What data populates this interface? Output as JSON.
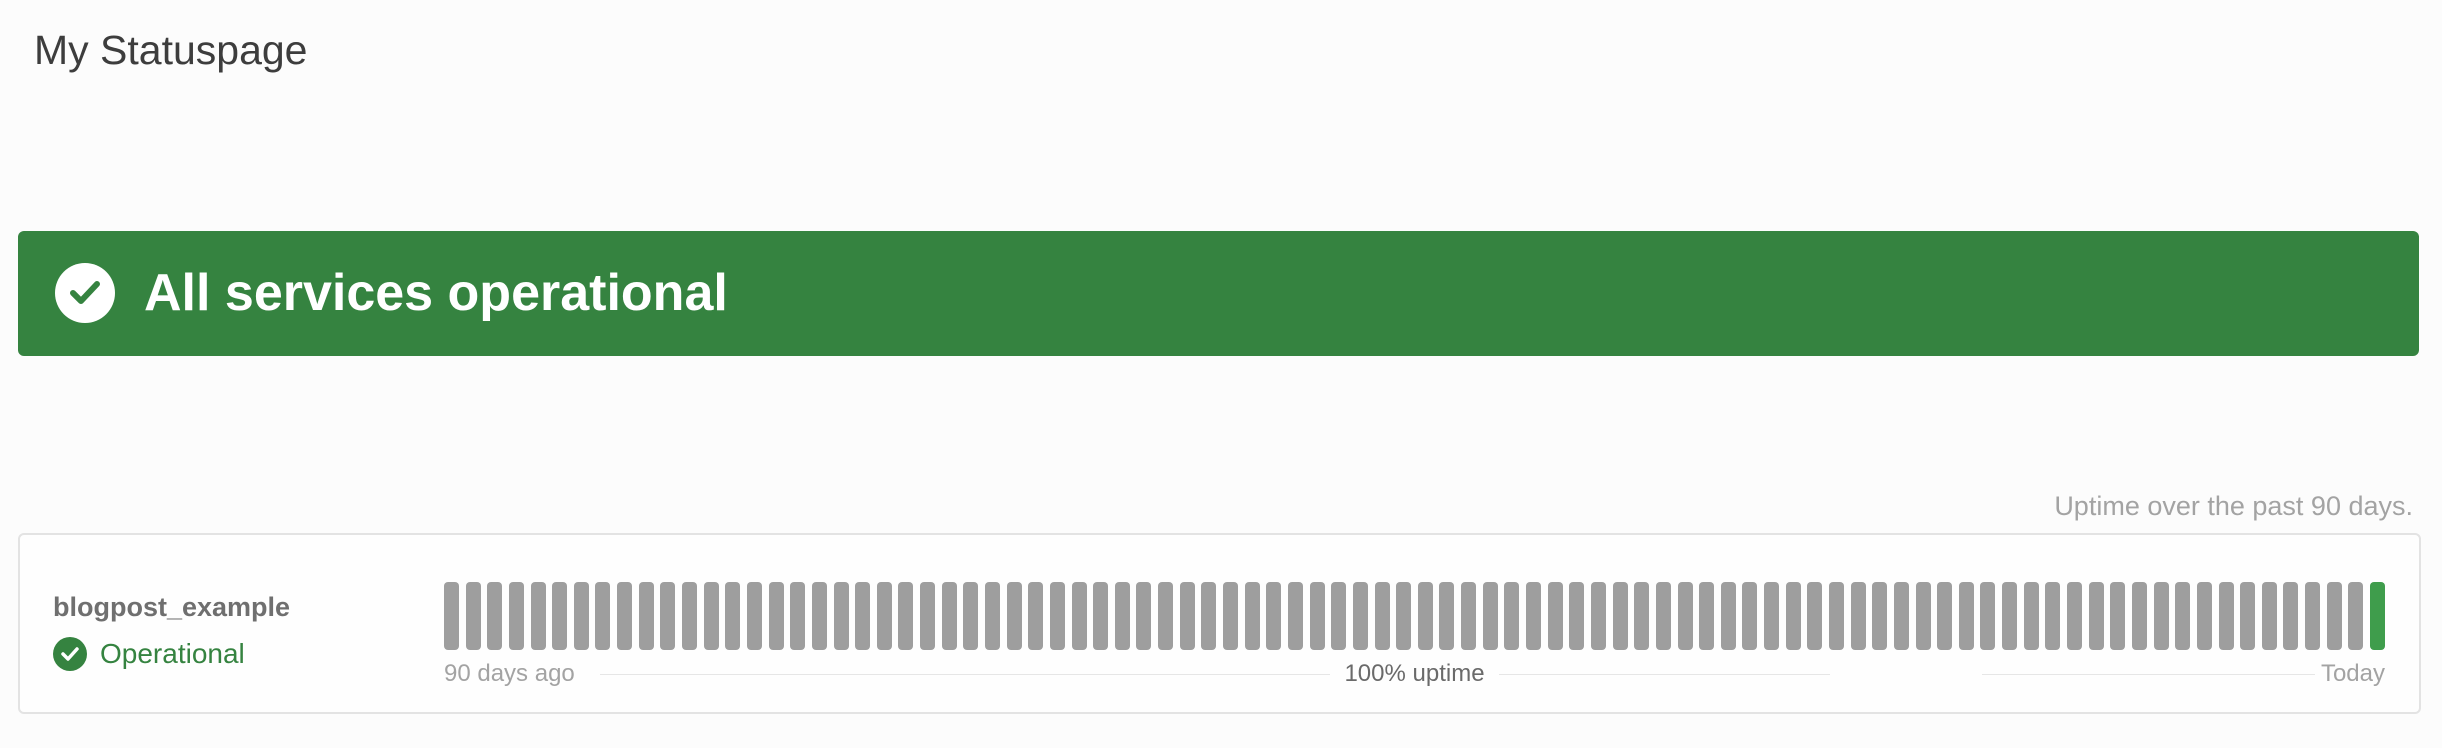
{
  "page": {
    "title": "My Statuspage"
  },
  "banner": {
    "icon": "check-circle-icon",
    "text": "All services operational",
    "color": "#358340"
  },
  "uptime_note": "Uptime over the past 90 days.",
  "components": [
    {
      "name": "blogpost_example",
      "status_icon": "check-circle-icon",
      "status": "Operational",
      "status_color": "#358340",
      "days_shown": 90,
      "days_with_data": 1,
      "no_data_color": "#9e9e9e",
      "up_color": "#3f9d4c",
      "timeline": {
        "start_label": "90 days ago",
        "uptime_label": "100% uptime",
        "end_label": "Today"
      }
    }
  ]
}
